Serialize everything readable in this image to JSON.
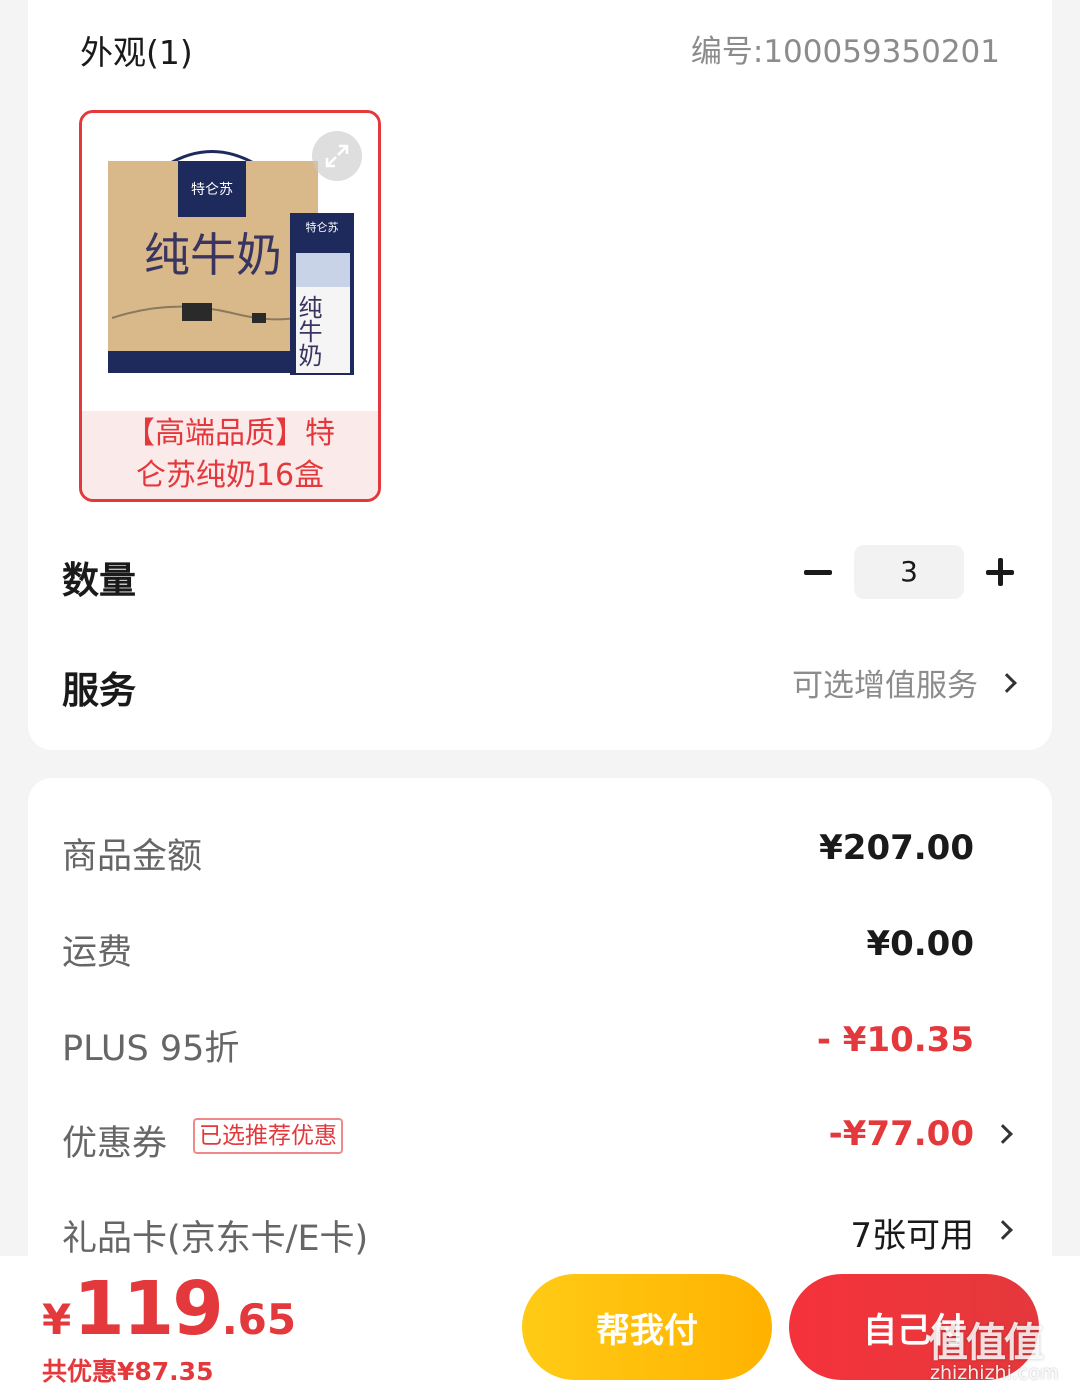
{
  "appearance": {
    "title": "外观(1)",
    "sku": "编号:100059350201",
    "product": {
      "caption_line1": "【高端品质】特",
      "caption_line2": "仑苏纯奶16盒",
      "box_brand": "特仑苏",
      "box_text": "纯牛奶",
      "carton_brand": "特仑苏",
      "carton_text": "纯牛奶",
      "image_accent": "#1f2a5c"
    }
  },
  "quantity": {
    "label": "数量",
    "value": "3"
  },
  "service": {
    "label": "服务",
    "link": "可选增值服务"
  },
  "fees": {
    "goods_label": "商品金额",
    "goods_value": "¥207.00",
    "shipping_label": "运费",
    "shipping_value": "¥0.00",
    "plus_label": "PLUS 95折",
    "plus_value": "- ¥10.35",
    "coupon_label": "优惠券",
    "coupon_tag": "已选推荐优惠",
    "coupon_value": "-¥77.00",
    "giftcard_label": "礼品卡(京东卡/E卡)",
    "giftcard_value": "7张可用"
  },
  "footer": {
    "currency": "¥",
    "total_int": "119",
    "total_dec": ".65",
    "discount": "共优惠¥87.35",
    "help_pay": "帮我付",
    "self_pay": "自己付"
  },
  "watermark": {
    "glyphs": "值值值",
    "url": "zhizhizhi.com"
  },
  "colors": {
    "accent": "#e4393c",
    "help_btn": "#ffbf0f",
    "muted_text": "#8c8c8c"
  }
}
